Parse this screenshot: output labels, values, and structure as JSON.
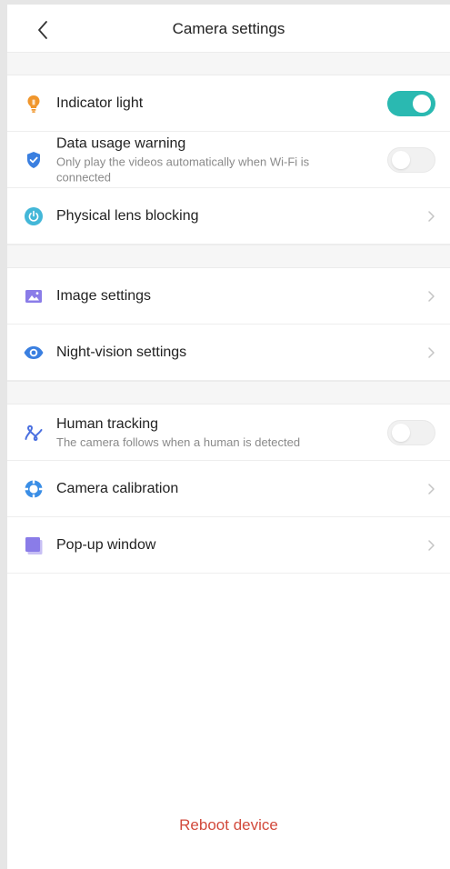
{
  "header": {
    "title": "Camera settings"
  },
  "section1": {
    "indicator_light": {
      "label": "Indicator light",
      "toggle": "on"
    },
    "data_usage": {
      "title": "Data usage warning",
      "subtitle": "Only play the videos automatically when Wi-Fi is connected",
      "toggle": "off"
    },
    "lens_blocking": {
      "label": "Physical lens blocking"
    }
  },
  "section2": {
    "image_settings": {
      "label": "Image settings"
    },
    "night_vision": {
      "label": "Night-vision settings"
    }
  },
  "section3": {
    "human_tracking": {
      "title": "Human tracking",
      "subtitle": "The camera follows when a human is detected",
      "toggle": "off"
    },
    "calibration": {
      "label": "Camera calibration"
    },
    "popup_window": {
      "label": "Pop-up window"
    }
  },
  "footer": {
    "reboot_label": "Reboot device"
  },
  "colors": {
    "accent_toggle": "#2ab9b1",
    "reboot_text": "#d24a3c",
    "icon_orange": "#f0962c",
    "icon_blue": "#3a7fe0",
    "icon_teal": "#43b7d8",
    "icon_purple": "#8a7ce8"
  },
  "icons": {
    "back": "chevron-left-icon",
    "indicator_light": "lightbulb-icon",
    "data_usage": "shield-check-icon",
    "lens_blocking": "power-circle-icon",
    "image_settings": "image-icon",
    "night_vision": "eye-icon",
    "human_tracking": "tracking-path-icon",
    "calibration": "calibration-icon",
    "popup_window": "window-icon"
  }
}
